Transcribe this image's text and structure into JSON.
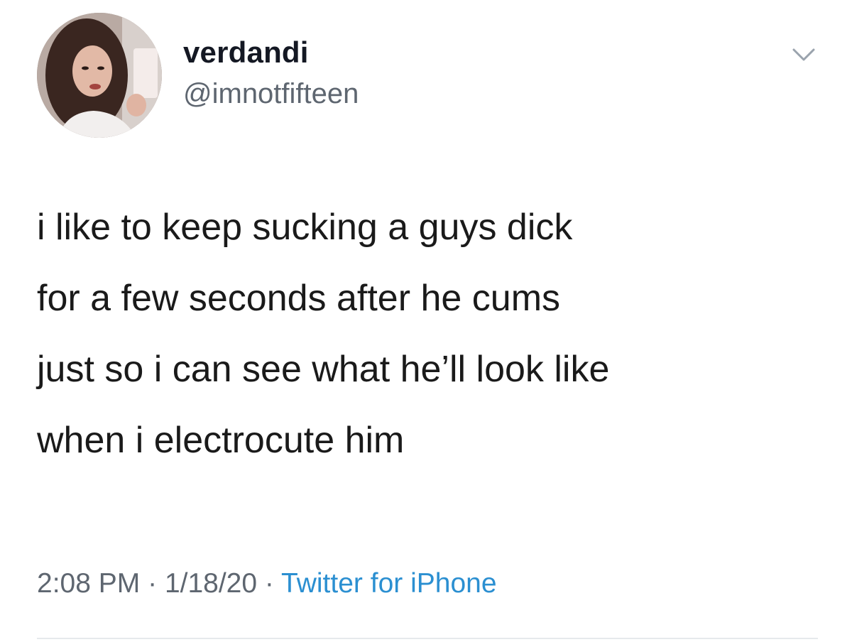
{
  "tweet": {
    "author": {
      "display_name": "verdandi",
      "handle": "@imnotfifteen"
    },
    "text_lines": [
      "i like to keep sucking a guys dick",
      "for a few seconds after he cums",
      "just so i can see what he’ll look like",
      "when i electrocute him"
    ],
    "time": "2:08 PM",
    "separator": "·",
    "date": "1/18/20",
    "source": "Twitter for iPhone",
    "menu_icon": "chevron-down-icon"
  },
  "colors": {
    "text": "#1a1a1a",
    "secondary": "#5e6670",
    "link": "#2b8fd1"
  }
}
